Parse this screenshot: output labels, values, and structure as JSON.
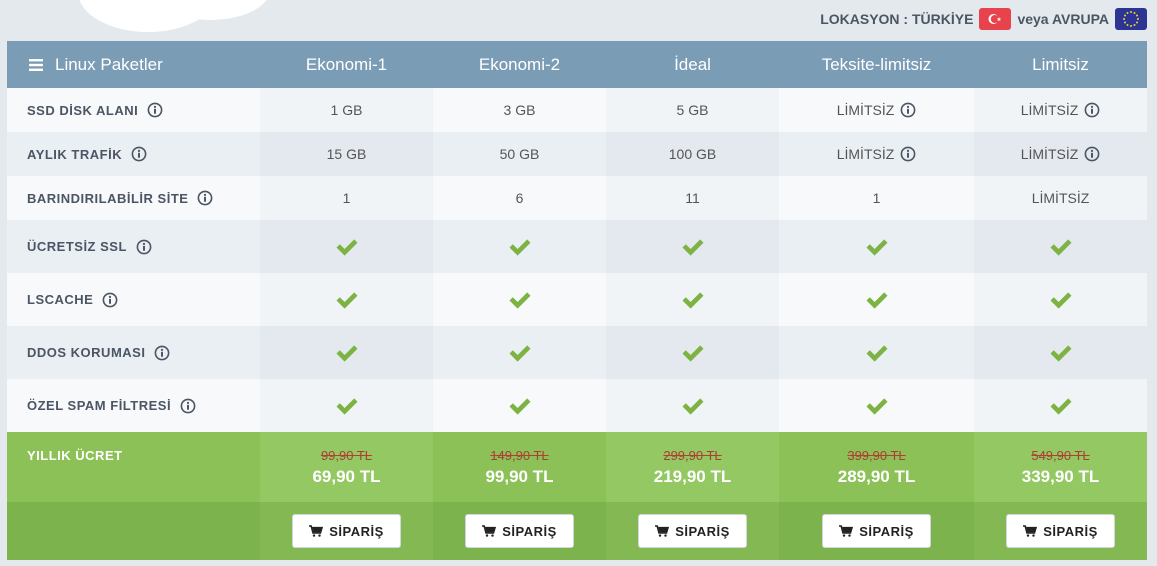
{
  "location": {
    "label": "LOKASYON : TÜRKİYE",
    "separator": "veya AVRUPA",
    "flags": [
      {
        "name": "tr-flag-icon",
        "color": "#e8434d"
      },
      {
        "name": "eu-flag-icon",
        "color": "#2c3594"
      }
    ]
  },
  "table": {
    "title": "Linux Paketler",
    "plans": [
      "Ekonomi-1",
      "Ekonomi-2",
      "İdeal",
      "Teksite-limitsiz",
      "Limitsiz"
    ],
    "features": [
      {
        "label": "SSD DİSK ALANI",
        "type": "text",
        "values": [
          "1 GB",
          "3 GB",
          "5 GB",
          "LİMİTSİZ",
          "LİMİTSİZ"
        ],
        "info": [
          false,
          false,
          false,
          true,
          true
        ]
      },
      {
        "label": "AYLIK TRAFİK",
        "type": "text",
        "values": [
          "15 GB",
          "50 GB",
          "100 GB",
          "LİMİTSİZ",
          "LİMİTSİZ"
        ],
        "info": [
          false,
          false,
          false,
          true,
          true
        ]
      },
      {
        "label": "BARINDIRILABİLİR SİTE",
        "type": "text",
        "values": [
          "1",
          "6",
          "11",
          "1",
          "LİMİTSİZ"
        ],
        "info": [
          false,
          false,
          false,
          false,
          false
        ]
      },
      {
        "label": "ÜCRETSİZ SSL",
        "type": "check",
        "values": [
          true,
          true,
          true,
          true,
          true
        ]
      },
      {
        "label": "LSCACHE",
        "type": "check",
        "values": [
          true,
          true,
          true,
          true,
          true
        ]
      },
      {
        "label": "DDOS KORUMASI",
        "type": "check",
        "values": [
          true,
          true,
          true,
          true,
          true
        ]
      },
      {
        "label": "ÖZEL SPAM FİLTRESİ",
        "type": "check",
        "values": [
          true,
          true,
          true,
          true,
          true
        ]
      }
    ],
    "price_label": "YILLIK ÜCRET",
    "prices": [
      {
        "old": "99,90 TL",
        "new": "69,90 TL"
      },
      {
        "old": "149,90 TL",
        "new": "99,90 TL"
      },
      {
        "old": "299,90 TL",
        "new": "219,90 TL"
      },
      {
        "old": "399,90 TL",
        "new": "289,90 TL"
      },
      {
        "old": "549,90 TL",
        "new": "339,90 TL"
      }
    ],
    "order_label": "SİPARİŞ"
  },
  "colors": {
    "header": "#7a9cb5",
    "check": "#7cb342",
    "price_row": "#8cc157",
    "old_price": "#a2413a"
  }
}
